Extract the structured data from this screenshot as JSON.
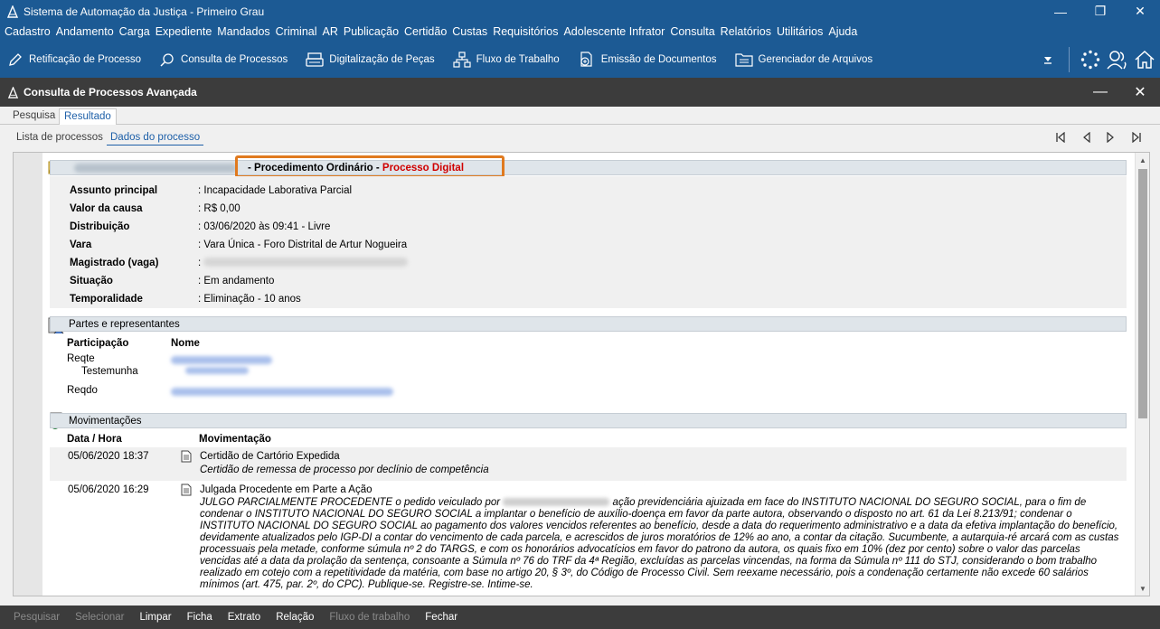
{
  "window": {
    "title": "Sistema de Automação da Justiça - Primeiro Grau",
    "controls": [
      "—",
      "❐",
      "✕"
    ]
  },
  "menu": [
    "Cadastro",
    "Andamento",
    "Carga",
    "Expediente",
    "Mandados",
    "Criminal",
    "AR",
    "Publicação",
    "Certidão",
    "Custas",
    "Requisitórios",
    "Adolescente Infrator",
    "Consulta",
    "Relatórios",
    "Utilitários",
    "Ajuda"
  ],
  "toolbar": [
    {
      "label": "Retificação de Processo",
      "icon": "pencil-icon"
    },
    {
      "label": "Consulta de Processos",
      "icon": "search-icon"
    },
    {
      "label": "Digitalização de Peças",
      "icon": "scanner-icon"
    },
    {
      "label": "Fluxo de Trabalho",
      "icon": "workflow-icon"
    },
    {
      "label": "Emissão de Documentos",
      "icon": "document-icon"
    },
    {
      "label": "Gerenciador de Arquivos",
      "icon": "folder-icon"
    }
  ],
  "inner_window": {
    "title": "Consulta de Processos Avançada"
  },
  "main_tabs": [
    "Pesquisa",
    "Resultado"
  ],
  "sub_tabs": [
    "Lista de processos",
    "Dados do processo"
  ],
  "process": {
    "class": "Procedimento Ordinário",
    "separator": " - ",
    "type": "Processo Digital",
    "type_color": "#d00000"
  },
  "details": [
    {
      "label": "Assunto principal",
      "value": "Incapacidade Laborativa Parcial"
    },
    {
      "label": "Valor da causa",
      "value": "R$ 0,00"
    },
    {
      "label": "Distribuição",
      "value": "03/06/2020 às 09:41 - Livre"
    },
    {
      "label": "Vara",
      "value": "Vara Única - Foro Distrital de Artur Nogueira"
    },
    {
      "label": "Magistrado (vaga)",
      "value": ""
    },
    {
      "label": "Situação",
      "value": "Em andamento"
    },
    {
      "label": "Temporalidade",
      "value": "Eliminação - 10 anos"
    }
  ],
  "partes": {
    "title": "Partes e representantes",
    "headers": [
      "Participação",
      "Nome"
    ],
    "rows": [
      "Reqte",
      "Testemunha",
      "Reqdo"
    ]
  },
  "movimentacoes": {
    "title": "Movimentações",
    "headers": [
      "Data / Hora",
      "Movimentação"
    ],
    "rows": [
      {
        "date": "05/06/2020 18:37",
        "title": "Certidão de Cartório Expedida",
        "text": "Certidão de remessa de processo por declínio de competência"
      },
      {
        "date": "05/06/2020 16:29",
        "title": "Julgada Procedente em Parte a Ação",
        "text_before_redaction": "JULGO PARCIALMENTE PROCEDENTE o pedido veiculado por",
        "text": "ação previdenciária ajuizada em face do INSTITUTO NACIONAL DO SEGURO SOCIAL, para o fim de condenar o INSTITUTO NACIONAL DO SEGURO SOCIAL a implantar o benefício de auxílio-doença em favor da parte autora, observando o disposto no art. 61 da Lei 8.213/91; condenar o INSTITUTO NACIONAL DO SEGURO SOCIAL ao pagamento dos valores vencidos referentes ao benefício, desde a data do requerimento administrativo e a data da efetiva implantação do benefício, devidamente atualizados pelo IGP-DI a contar do vencimento de cada parcela, e acrescidos de juros moratórios de 12% ao ano, a contar da citação. Sucumbente, a autarquia-ré arcará com as custas processuais pela metade, conforme súmula nº 2 do TARGS, e com os honorários advocatícios em favor do patrono da autora, os quais fixo em 10% (dez por cento) sobre o valor das parcelas vencidas até a data da prolação da sentença, consoante a Súmula nº 76 do TRF da 4ª Região, excluídas as parcelas vincendas, na forma da Súmula nº 111 do STJ, considerando o bom trabalho realizado em cotejo com a repetitividade da matéria, com base no artigo 20, § 3º, do Código de Processo Civil. Sem reexame necessário, pois a condenação certamente não excede 60 salários mínimos (art. 475, par. 2º, do CPC). Publique-se. Registre-se. Intime-se."
      }
    ]
  },
  "bottom_actions": [
    {
      "label": "Pesquisar",
      "enabled": false
    },
    {
      "label": "Selecionar",
      "enabled": false
    },
    {
      "label": "Limpar",
      "enabled": true
    },
    {
      "label": "Ficha",
      "enabled": true
    },
    {
      "label": "Extrato",
      "enabled": true
    },
    {
      "label": "Relação",
      "enabled": true
    },
    {
      "label": "Fluxo de trabalho",
      "enabled": false
    },
    {
      "label": "Fechar",
      "enabled": true
    }
  ]
}
